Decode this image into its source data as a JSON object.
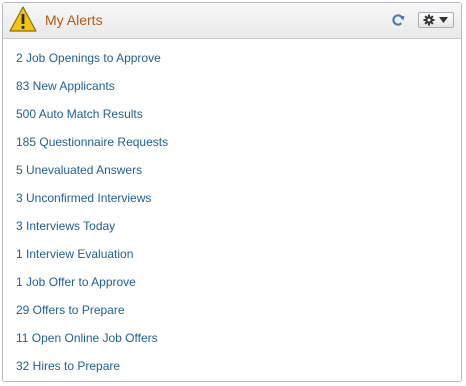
{
  "pagelet": {
    "title": "My Alerts",
    "icons": {
      "header": "warning-icon",
      "refresh": "refresh-icon",
      "actions": "gear-icon"
    },
    "colors": {
      "title": "#b35a14",
      "link": "#1f5f95",
      "warning": "#f2c418"
    }
  },
  "alerts": [
    "2 Job Openings to Approve",
    "83 New Applicants",
    "500 Auto Match Results",
    "185 Questionnaire Requests",
    "5 Unevaluated Answers",
    "3 Unconfirmed Interviews",
    "3 Interviews Today",
    "1 Interview Evaluation",
    "1 Job Offer to Approve",
    "29 Offers to Prepare",
    "11 Open Online Job Offers",
    "32 Hires to Prepare"
  ]
}
